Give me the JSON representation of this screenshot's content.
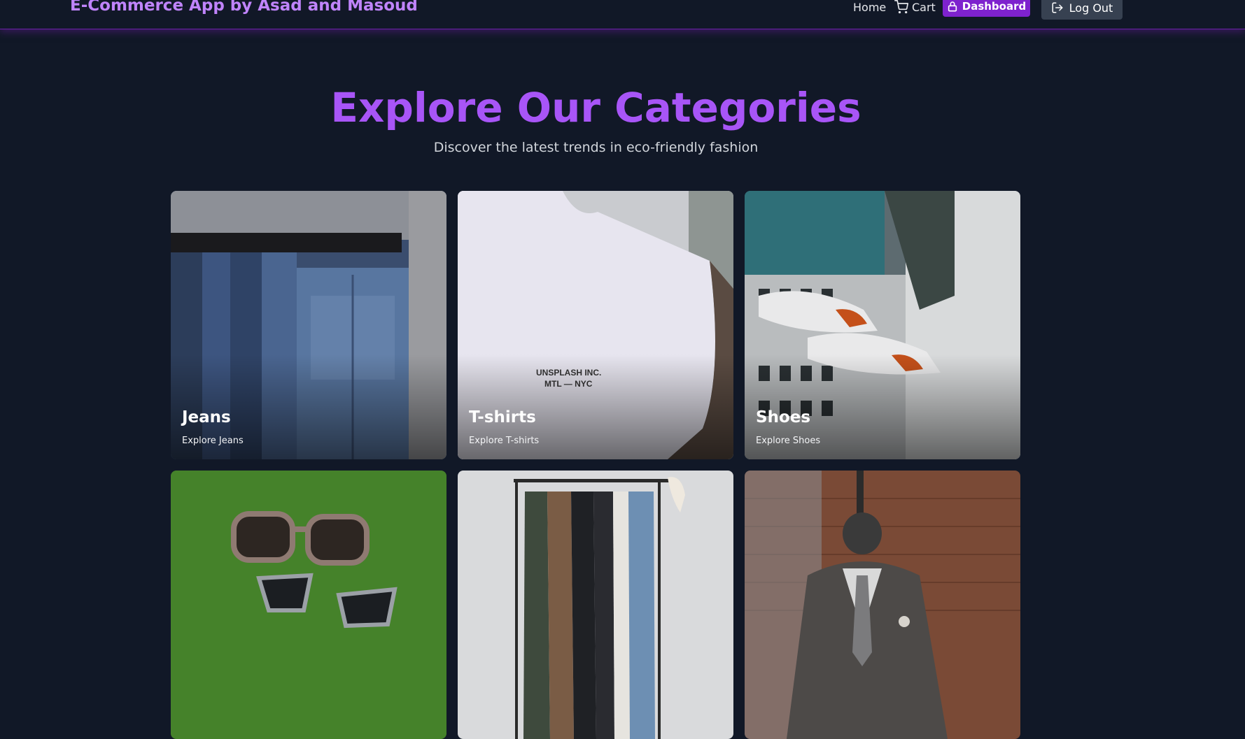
{
  "navbar": {
    "brand": "E-Commerce App by Asad and Masoud",
    "home_label": "Home",
    "cart_label": "Cart",
    "dashboard_label": "Dashboard",
    "logout_label": "Log Out"
  },
  "hero": {
    "title": "Explore Our Categories",
    "subtitle": "Discover the latest trends in eco-friendly fashion"
  },
  "categories": [
    {
      "title": "Jeans",
      "subtitle": "Explore Jeans"
    },
    {
      "title": "T-shirts",
      "subtitle": "Explore T-shirts",
      "print_text": "UNSPLASH INC.\nMTL — NYC"
    },
    {
      "title": "Shoes",
      "subtitle": "Explore Shoes"
    },
    {
      "title": "",
      "subtitle": ""
    },
    {
      "title": "",
      "subtitle": ""
    },
    {
      "title": "",
      "subtitle": ""
    }
  ],
  "colors": {
    "background": "#111827",
    "brand": "#c084fc",
    "accent": "#a855f7",
    "dashboard_button": "#7e22ce",
    "logout_button": "#374151"
  },
  "icons": {
    "cart": "cart-icon",
    "dashboard": "lock-icon",
    "logout": "logout-icon"
  }
}
